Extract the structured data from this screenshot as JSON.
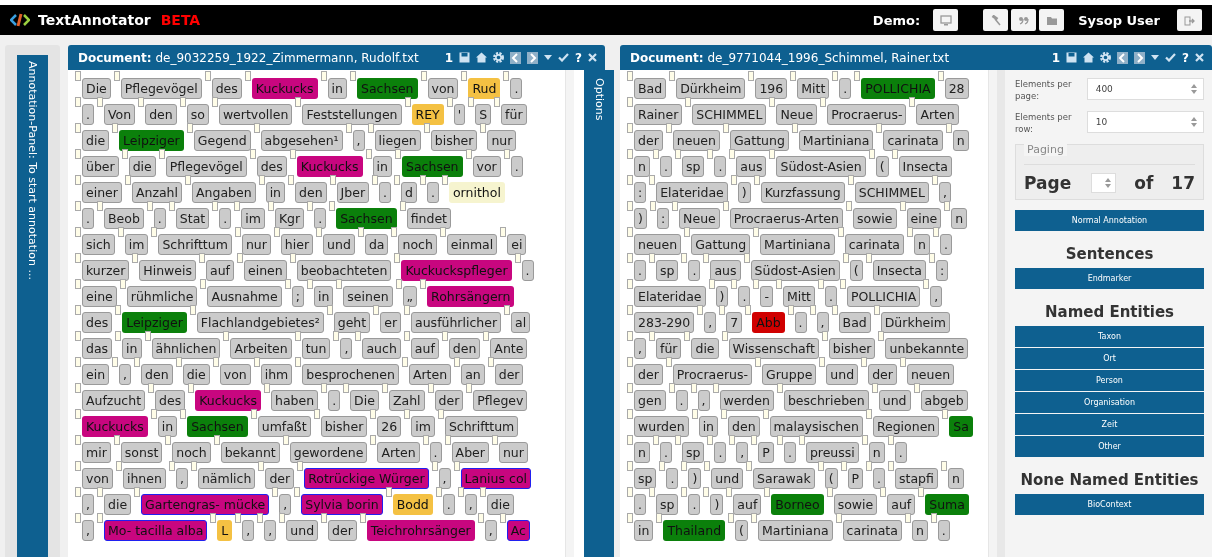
{
  "topbar": {
    "logo": "TextAnnotator",
    "badge": "BETA",
    "demo_label": "Demo:",
    "user": "Sysop User"
  },
  "annotation_panel": {
    "label": "Annotation-Panel: To start annotation ..."
  },
  "documents": [
    {
      "label": "Document:",
      "filename": "de_9032259_1922_Zimmermann, Rudolf.txt",
      "page": "1",
      "help": "?",
      "options_tab": "Options",
      "lines": [
        {
          "tokens": [
            {
              "text": "Die",
              "kind": "plain"
            },
            {
              "text": "Pflegevögel",
              "kind": "plain"
            },
            {
              "text": "des",
              "kind": "plain"
            },
            {
              "text": "Kuckucks",
              "kind": "entity",
              "color": "#c8067f"
            },
            {
              "text": "in",
              "kind": "plain"
            },
            {
              "text": "Sachsen",
              "kind": "entity",
              "color": "#0b800b"
            },
            {
              "text": "von",
              "kind": "plain"
            },
            {
              "text": "Rud",
              "kind": "entity",
              "color": "#f4c143"
            },
            {
              "text": ".",
              "kind": "plain"
            }
          ]
        },
        {
          "tokens": [
            {
              "text": ".",
              "kind": "plain"
            },
            {
              "text": "Von",
              "kind": "plain"
            },
            {
              "text": "den",
              "kind": "plain"
            },
            {
              "text": "so",
              "kind": "plain"
            },
            {
              "text": "wertvollen",
              "kind": "plain"
            },
            {
              "text": "Feststellungen",
              "kind": "plain"
            },
            {
              "text": "REY",
              "kind": "entity",
              "color": "#f4c143"
            },
            {
              "text": "'",
              "kind": "plain"
            },
            {
              "text": "S",
              "kind": "plain"
            },
            {
              "text": "für",
              "kind": "plain"
            }
          ]
        },
        {
          "tokens": [
            {
              "text": "die",
              "kind": "plain"
            },
            {
              "text": "Leipziger",
              "kind": "entity",
              "color": "#0b800b"
            },
            {
              "text": "Gegend",
              "kind": "plain"
            },
            {
              "text": "abgesehen¹",
              "kind": "plain"
            },
            {
              "text": ",",
              "kind": "plain"
            },
            {
              "text": "liegen",
              "kind": "plain"
            },
            {
              "text": "bisher",
              "kind": "plain"
            },
            {
              "text": "nur",
              "kind": "plain"
            }
          ]
        },
        {
          "tokens": [
            {
              "text": "über",
              "kind": "plain"
            },
            {
              "text": "die",
              "kind": "plain"
            },
            {
              "text": "Pflegevögel",
              "kind": "plain"
            },
            {
              "text": "des",
              "kind": "plain"
            },
            {
              "text": "Kuckucks",
              "kind": "entity",
              "color": "#c8067f"
            },
            {
              "text": "in",
              "kind": "plain"
            },
            {
              "text": "Sachsen",
              "kind": "entity",
              "color": "#0b800b"
            },
            {
              "text": "vor",
              "kind": "plain"
            },
            {
              "text": ".",
              "kind": "plain"
            }
          ]
        },
        {
          "tokens": [
            {
              "text": "einer",
              "kind": "plain"
            },
            {
              "text": "Anzahl",
              "kind": "plain"
            },
            {
              "text": "Angaben",
              "kind": "plain"
            },
            {
              "text": "in",
              "kind": "plain"
            },
            {
              "text": "den",
              "kind": "plain"
            },
            {
              "text": "Jber",
              "kind": "plain"
            },
            {
              "text": ".",
              "kind": "plain"
            },
            {
              "text": "d",
              "kind": "plain"
            },
            {
              "text": ".",
              "kind": "plain"
            },
            {
              "text": "ornithol",
              "kind": "entity",
              "color": "#f6f4cf"
            }
          ]
        },
        {
          "tokens": [
            {
              "text": ".",
              "kind": "plain"
            },
            {
              "text": "Beob",
              "kind": "plain"
            },
            {
              "text": ".",
              "kind": "plain"
            },
            {
              "text": "Stat",
              "kind": "plain"
            },
            {
              "text": ".",
              "kind": "plain"
            },
            {
              "text": "im",
              "kind": "plain"
            },
            {
              "text": "Kgr",
              "kind": "plain"
            },
            {
              "text": ".",
              "kind": "plain"
            },
            {
              "text": "Sachsen",
              "kind": "entity",
              "color": "#0b800b"
            },
            {
              "text": "findet",
              "kind": "plain"
            }
          ]
        },
        {
          "tokens": [
            {
              "text": "sich",
              "kind": "plain"
            },
            {
              "text": "im",
              "kind": "plain"
            },
            {
              "text": "Schrifttum",
              "kind": "plain"
            },
            {
              "text": "nur",
              "kind": "plain"
            },
            {
              "text": "hier",
              "kind": "plain"
            },
            {
              "text": "und",
              "kind": "plain"
            },
            {
              "text": "da",
              "kind": "plain"
            },
            {
              "text": "noch",
              "kind": "plain"
            },
            {
              "text": "einmal",
              "kind": "plain"
            },
            {
              "text": "ei",
              "kind": "plain"
            }
          ]
        },
        {
          "tokens": [
            {
              "text": "kurzer",
              "kind": "plain"
            },
            {
              "text": "Hinweis",
              "kind": "plain"
            },
            {
              "text": "auf",
              "kind": "plain"
            },
            {
              "text": "einen",
              "kind": "plain"
            },
            {
              "text": "beobachteten",
              "kind": "plain"
            },
            {
              "text": "Kuckuckspfleger",
              "kind": "entity",
              "color": "#c8067f"
            },
            {
              "text": ".",
              "kind": "plain"
            }
          ]
        },
        {
          "tokens": [
            {
              "text": "eine",
              "kind": "plain"
            },
            {
              "text": "rühmliche",
              "kind": "plain"
            },
            {
              "text": "Ausnahme",
              "kind": "plain"
            },
            {
              "text": ";",
              "kind": "plain"
            },
            {
              "text": "in",
              "kind": "plain"
            },
            {
              "text": "seinen",
              "kind": "plain"
            },
            {
              "text": "„",
              "kind": "plain"
            },
            {
              "text": "Rohrsängern",
              "kind": "entity",
              "color": "#c8067f"
            }
          ]
        },
        {
          "tokens": [
            {
              "text": "des",
              "kind": "plain"
            },
            {
              "text": "Leipziger",
              "kind": "entity",
              "color": "#0b800b"
            },
            {
              "text": "Flachlandgebietes²",
              "kind": "plain"
            },
            {
              "text": "geht",
              "kind": "plain"
            },
            {
              "text": "er",
              "kind": "plain"
            },
            {
              "text": "ausführlicher",
              "kind": "plain"
            },
            {
              "text": "al",
              "kind": "plain"
            }
          ]
        },
        {
          "tokens": [
            {
              "text": "das",
              "kind": "plain"
            },
            {
              "text": "in",
              "kind": "plain"
            },
            {
              "text": "ähnlichen",
              "kind": "plain"
            },
            {
              "text": "Arbeiten",
              "kind": "plain"
            },
            {
              "text": "tun",
              "kind": "plain"
            },
            {
              "text": ",",
              "kind": "plain"
            },
            {
              "text": "auch",
              "kind": "plain"
            },
            {
              "text": "auf",
              "kind": "plain"
            },
            {
              "text": "den",
              "kind": "plain"
            },
            {
              "text": "Ante",
              "kind": "plain"
            }
          ]
        },
        {
          "tokens": [
            {
              "text": "ein",
              "kind": "plain"
            },
            {
              "text": ",",
              "kind": "plain"
            },
            {
              "text": "den",
              "kind": "plain"
            },
            {
              "text": "die",
              "kind": "plain"
            },
            {
              "text": "von",
              "kind": "plain"
            },
            {
              "text": "ihm",
              "kind": "plain"
            },
            {
              "text": "besprochenen",
              "kind": "plain"
            },
            {
              "text": "Arten",
              "kind": "plain"
            },
            {
              "text": "an",
              "kind": "plain"
            },
            {
              "text": "der",
              "kind": "plain"
            }
          ]
        },
        {
          "tokens": [
            {
              "text": "Aufzucht",
              "kind": "plain"
            },
            {
              "text": "des",
              "kind": "plain"
            },
            {
              "text": "Kuckucks",
              "kind": "entity",
              "color": "#c8067f"
            },
            {
              "text": "haben",
              "kind": "plain"
            },
            {
              "text": ".",
              "kind": "plain"
            },
            {
              "text": "Die",
              "kind": "plain"
            },
            {
              "text": "Zahl",
              "kind": "plain"
            },
            {
              "text": "der",
              "kind": "plain"
            },
            {
              "text": "Pflegev",
              "kind": "plain"
            }
          ]
        },
        {
          "tokens": [
            {
              "text": "Kuckucks",
              "kind": "entity",
              "color": "#c8067f"
            },
            {
              "text": "in",
              "kind": "plain"
            },
            {
              "text": "Sachsen",
              "kind": "entity",
              "color": "#0b800b"
            },
            {
              "text": "umfaßt",
              "kind": "plain"
            },
            {
              "text": "bisher",
              "kind": "plain"
            },
            {
              "text": "26",
              "kind": "plain"
            },
            {
              "text": "im",
              "kind": "plain"
            },
            {
              "text": "Schrifttum",
              "kind": "plain"
            }
          ]
        },
        {
          "tokens": [
            {
              "text": "mir",
              "kind": "plain"
            },
            {
              "text": "sonst",
              "kind": "plain"
            },
            {
              "text": "noch",
              "kind": "plain"
            },
            {
              "text": "bekannt",
              "kind": "plain"
            },
            {
              "text": "gewordene",
              "kind": "plain"
            },
            {
              "text": "Arten",
              "kind": "plain"
            },
            {
              "text": ".",
              "kind": "plain"
            },
            {
              "text": "Aber",
              "kind": "plain"
            },
            {
              "text": "nur",
              "kind": "plain"
            }
          ]
        },
        {
          "tokens": [
            {
              "text": "von",
              "kind": "plain"
            },
            {
              "text": "ihnen",
              "kind": "plain"
            },
            {
              "text": ",",
              "kind": "plain"
            },
            {
              "text": "nämlich",
              "kind": "plain"
            },
            {
              "text": "der",
              "kind": "plain"
            },
            {
              "text": "Rotrückige Würger",
              "kind": "linked",
              "color": "#c8067f"
            },
            {
              "text": ",",
              "kind": "plain"
            },
            {
              "text": "Lanius col",
              "kind": "linked",
              "color": "#c8067f"
            }
          ]
        },
        {
          "tokens": [
            {
              "text": ",",
              "kind": "plain"
            },
            {
              "text": "die",
              "kind": "plain"
            },
            {
              "text": "Gartengras- mücke",
              "kind": "linked",
              "color": "#c8067f"
            },
            {
              "text": ",",
              "kind": "plain"
            },
            {
              "text": "Sylvia borin",
              "kind": "linked",
              "color": "#c8067f"
            },
            {
              "text": "Bodd",
              "kind": "entity",
              "color": "#f4c143"
            },
            {
              "text": ".",
              "kind": "plain"
            },
            {
              "text": ",",
              "kind": "plain"
            },
            {
              "text": "die",
              "kind": "plain"
            }
          ]
        },
        {
          "tokens": [
            {
              "text": ",",
              "kind": "plain"
            },
            {
              "text": "Mo- tacilla alba",
              "kind": "linked",
              "color": "#c8067f"
            },
            {
              "text": "L",
              "kind": "entity",
              "color": "#f4c143"
            },
            {
              "text": ",",
              "kind": "plain"
            },
            {
              "text": ",",
              "kind": "plain"
            },
            {
              "text": "und",
              "kind": "plain"
            },
            {
              "text": "der",
              "kind": "plain"
            },
            {
              "text": "Teichrohrsänger",
              "kind": "entity",
              "color": "#c8067f"
            },
            {
              "text": ",",
              "kind": "plain"
            },
            {
              "text": "Ac",
              "kind": "linked",
              "color": "#c8067f"
            }
          ]
        }
      ]
    },
    {
      "label": "Document:",
      "filename": "de_9771044_1996_Schimmel, Rainer.txt",
      "page": "1",
      "help": "?",
      "lines": [
        {
          "tokens": [
            {
              "text": "Bad",
              "kind": "plain"
            },
            {
              "text": "Dürkheim",
              "kind": "plain"
            },
            {
              "text": "196",
              "kind": "plain"
            },
            {
              "text": "Mitt",
              "kind": "plain"
            },
            {
              "text": ".",
              "kind": "plain"
            },
            {
              "text": "POLLICHIA",
              "kind": "entity",
              "color": "#0b800b"
            },
            {
              "text": "28",
              "kind": "plain"
            }
          ]
        },
        {
          "tokens": [
            {
              "text": "Rainer",
              "kind": "plain"
            },
            {
              "text": "SCHIMMEL",
              "kind": "plain"
            },
            {
              "text": "Neue",
              "kind": "plain"
            },
            {
              "text": "Procraerus-",
              "kind": "plain"
            },
            {
              "text": "Arten",
              "kind": "plain"
            }
          ]
        },
        {
          "tokens": [
            {
              "text": "der",
              "kind": "plain"
            },
            {
              "text": "neuen",
              "kind": "plain"
            },
            {
              "text": "Gattung",
              "kind": "plain"
            },
            {
              "text": "Martiniana",
              "kind": "plain"
            },
            {
              "text": "carinata",
              "kind": "plain"
            },
            {
              "text": "n",
              "kind": "plain"
            }
          ]
        },
        {
          "tokens": [
            {
              "text": "n",
              "kind": "plain"
            },
            {
              "text": ".",
              "kind": "plain"
            },
            {
              "text": "sp",
              "kind": "plain"
            },
            {
              "text": ".",
              "kind": "plain"
            },
            {
              "text": "aus",
              "kind": "plain"
            },
            {
              "text": "Südost-Asien",
              "kind": "plain"
            },
            {
              "text": "(",
              "kind": "plain"
            },
            {
              "text": "Insecta",
              "kind": "plain"
            }
          ]
        },
        {
          "tokens": [
            {
              "text": ":",
              "kind": "plain"
            },
            {
              "text": "Elateridae",
              "kind": "plain"
            },
            {
              "text": ")",
              "kind": "plain"
            },
            {
              "text": "Kurzfassung",
              "kind": "plain"
            },
            {
              "text": "SCHIMMEL",
              "kind": "plain"
            },
            {
              "text": ",",
              "kind": "plain"
            }
          ]
        },
        {
          "tokens": [
            {
              "text": ")",
              "kind": "plain"
            },
            {
              "text": ":",
              "kind": "plain"
            },
            {
              "text": "Neue",
              "kind": "plain"
            },
            {
              "text": "Procraerus-Arten",
              "kind": "plain"
            },
            {
              "text": "sowie",
              "kind": "plain"
            },
            {
              "text": "eine",
              "kind": "plain"
            },
            {
              "text": "n",
              "kind": "plain"
            }
          ]
        },
        {
          "tokens": [
            {
              "text": "neuen",
              "kind": "plain"
            },
            {
              "text": "Gattung",
              "kind": "plain"
            },
            {
              "text": "Martiniana",
              "kind": "plain"
            },
            {
              "text": "carinata",
              "kind": "plain"
            },
            {
              "text": "n",
              "kind": "plain"
            },
            {
              "text": ".",
              "kind": "plain"
            }
          ]
        },
        {
          "tokens": [
            {
              "text": ".",
              "kind": "plain"
            },
            {
              "text": "sp",
              "kind": "plain"
            },
            {
              "text": ".",
              "kind": "plain"
            },
            {
              "text": "aus",
              "kind": "plain"
            },
            {
              "text": "Südost-Asien",
              "kind": "plain"
            },
            {
              "text": "(",
              "kind": "plain"
            },
            {
              "text": "Insecta",
              "kind": "plain"
            },
            {
              "text": ":",
              "kind": "plain"
            }
          ]
        },
        {
          "tokens": [
            {
              "text": "Elateridae",
              "kind": "plain"
            },
            {
              "text": ")",
              "kind": "plain"
            },
            {
              "text": ".",
              "kind": "plain"
            },
            {
              "text": "-",
              "kind": "plain"
            },
            {
              "text": "Mitt",
              "kind": "plain"
            },
            {
              "text": ".",
              "kind": "plain"
            },
            {
              "text": "POLLICHIA",
              "kind": "plain"
            },
            {
              "text": ",",
              "kind": "plain"
            }
          ]
        },
        {
          "tokens": [
            {
              "text": "283-290",
              "kind": "plain"
            },
            {
              "text": ",",
              "kind": "plain"
            },
            {
              "text": "7",
              "kind": "plain"
            },
            {
              "text": "Abb",
              "kind": "entity",
              "color": "#d00000"
            },
            {
              "text": ".",
              "kind": "plain"
            },
            {
              "text": ",",
              "kind": "plain"
            },
            {
              "text": "Bad",
              "kind": "plain"
            },
            {
              "text": "Dürkheim",
              "kind": "plain"
            }
          ]
        },
        {
          "tokens": [
            {
              "text": ",",
              "kind": "plain"
            },
            {
              "text": "für",
              "kind": "plain"
            },
            {
              "text": "die",
              "kind": "plain"
            },
            {
              "text": "Wissenschaft",
              "kind": "plain"
            },
            {
              "text": "bisher",
              "kind": "plain"
            },
            {
              "text": "unbekannte",
              "kind": "plain"
            }
          ]
        },
        {
          "tokens": [
            {
              "text": "der",
              "kind": "plain"
            },
            {
              "text": "Procraerus-",
              "kind": "plain"
            },
            {
              "text": "Gruppe",
              "kind": "plain"
            },
            {
              "text": "und",
              "kind": "plain"
            },
            {
              "text": "der",
              "kind": "plain"
            },
            {
              "text": "neuen",
              "kind": "plain"
            }
          ]
        },
        {
          "tokens": [
            {
              "text": "gen",
              "kind": "plain"
            },
            {
              "text": ".",
              "kind": "plain"
            },
            {
              "text": ",",
              "kind": "plain"
            },
            {
              "text": "werden",
              "kind": "plain"
            },
            {
              "text": "beschrieben",
              "kind": "plain"
            },
            {
              "text": "und",
              "kind": "plain"
            },
            {
              "text": "abgeb",
              "kind": "plain"
            }
          ]
        },
        {
          "tokens": [
            {
              "text": "wurden",
              "kind": "plain"
            },
            {
              "text": "in",
              "kind": "plain"
            },
            {
              "text": "den",
              "kind": "plain"
            },
            {
              "text": "malaysischen",
              "kind": "plain"
            },
            {
              "text": "Regionen",
              "kind": "plain"
            },
            {
              "text": "Sa",
              "kind": "entity",
              "color": "#0b800b"
            }
          ]
        },
        {
          "tokens": [
            {
              "text": "n",
              "kind": "plain"
            },
            {
              "text": ".",
              "kind": "plain"
            },
            {
              "text": "sp",
              "kind": "plain"
            },
            {
              "text": ".",
              "kind": "plain"
            },
            {
              "text": ",",
              "kind": "plain"
            },
            {
              "text": "P",
              "kind": "plain"
            },
            {
              "text": ".",
              "kind": "plain"
            },
            {
              "text": "preussi",
              "kind": "plain"
            },
            {
              "text": "n",
              "kind": "plain"
            },
            {
              "text": ".",
              "kind": "plain"
            }
          ]
        },
        {
          "tokens": [
            {
              "text": "sp",
              "kind": "plain"
            },
            {
              "text": ".",
              "kind": "plain"
            },
            {
              "text": ")",
              "kind": "plain"
            },
            {
              "text": "und",
              "kind": "plain"
            },
            {
              "text": "Sarawak",
              "kind": "plain"
            },
            {
              "text": "(",
              "kind": "plain"
            },
            {
              "text": "P",
              "kind": "plain"
            },
            {
              "text": ".",
              "kind": "plain"
            },
            {
              "text": "stapfi",
              "kind": "plain"
            },
            {
              "text": "n",
              "kind": "plain"
            }
          ]
        },
        {
          "tokens": [
            {
              "text": ".",
              "kind": "plain"
            },
            {
              "text": "sp",
              "kind": "plain"
            },
            {
              "text": ".",
              "kind": "plain"
            },
            {
              "text": ")",
              "kind": "plain"
            },
            {
              "text": "auf",
              "kind": "plain"
            },
            {
              "text": "Borneo",
              "kind": "entity",
              "color": "#0b800b"
            },
            {
              "text": "sowie",
              "kind": "plain"
            },
            {
              "text": "auf",
              "kind": "plain"
            },
            {
              "text": "Suma",
              "kind": "entity",
              "color": "#0b800b"
            }
          ]
        },
        {
          "tokens": [
            {
              "text": "in",
              "kind": "plain"
            },
            {
              "text": "Thailand",
              "kind": "entity",
              "color": "#0b800b"
            },
            {
              "text": "(",
              "kind": "plain"
            },
            {
              "text": "Martiniana",
              "kind": "plain"
            },
            {
              "text": "carinata",
              "kind": "plain"
            },
            {
              "text": "n",
              "kind": "plain"
            },
            {
              "text": ".",
              "kind": "plain"
            }
          ]
        }
      ],
      "options": {
        "fields": [
          {
            "label": "Elements per page:",
            "value": "400"
          },
          {
            "label": "Elements per row:",
            "value": "10"
          }
        ],
        "paging": {
          "legend": "Paging",
          "page_label": "Page",
          "of_label": "of",
          "total": "17"
        },
        "sections": [
          {
            "buttons": [
              "Normal Annotation"
            ]
          },
          {
            "heading": "Sentences",
            "buttons": [
              "Endmarker"
            ]
          },
          {
            "heading": "Named Entities",
            "buttons": [
              "Taxon",
              "Ort",
              "Person",
              "Organisation",
              "Zeit",
              "Other"
            ]
          },
          {
            "heading": "None Named Entities",
            "buttons": [
              "BioContext"
            ]
          }
        ]
      }
    }
  ]
}
